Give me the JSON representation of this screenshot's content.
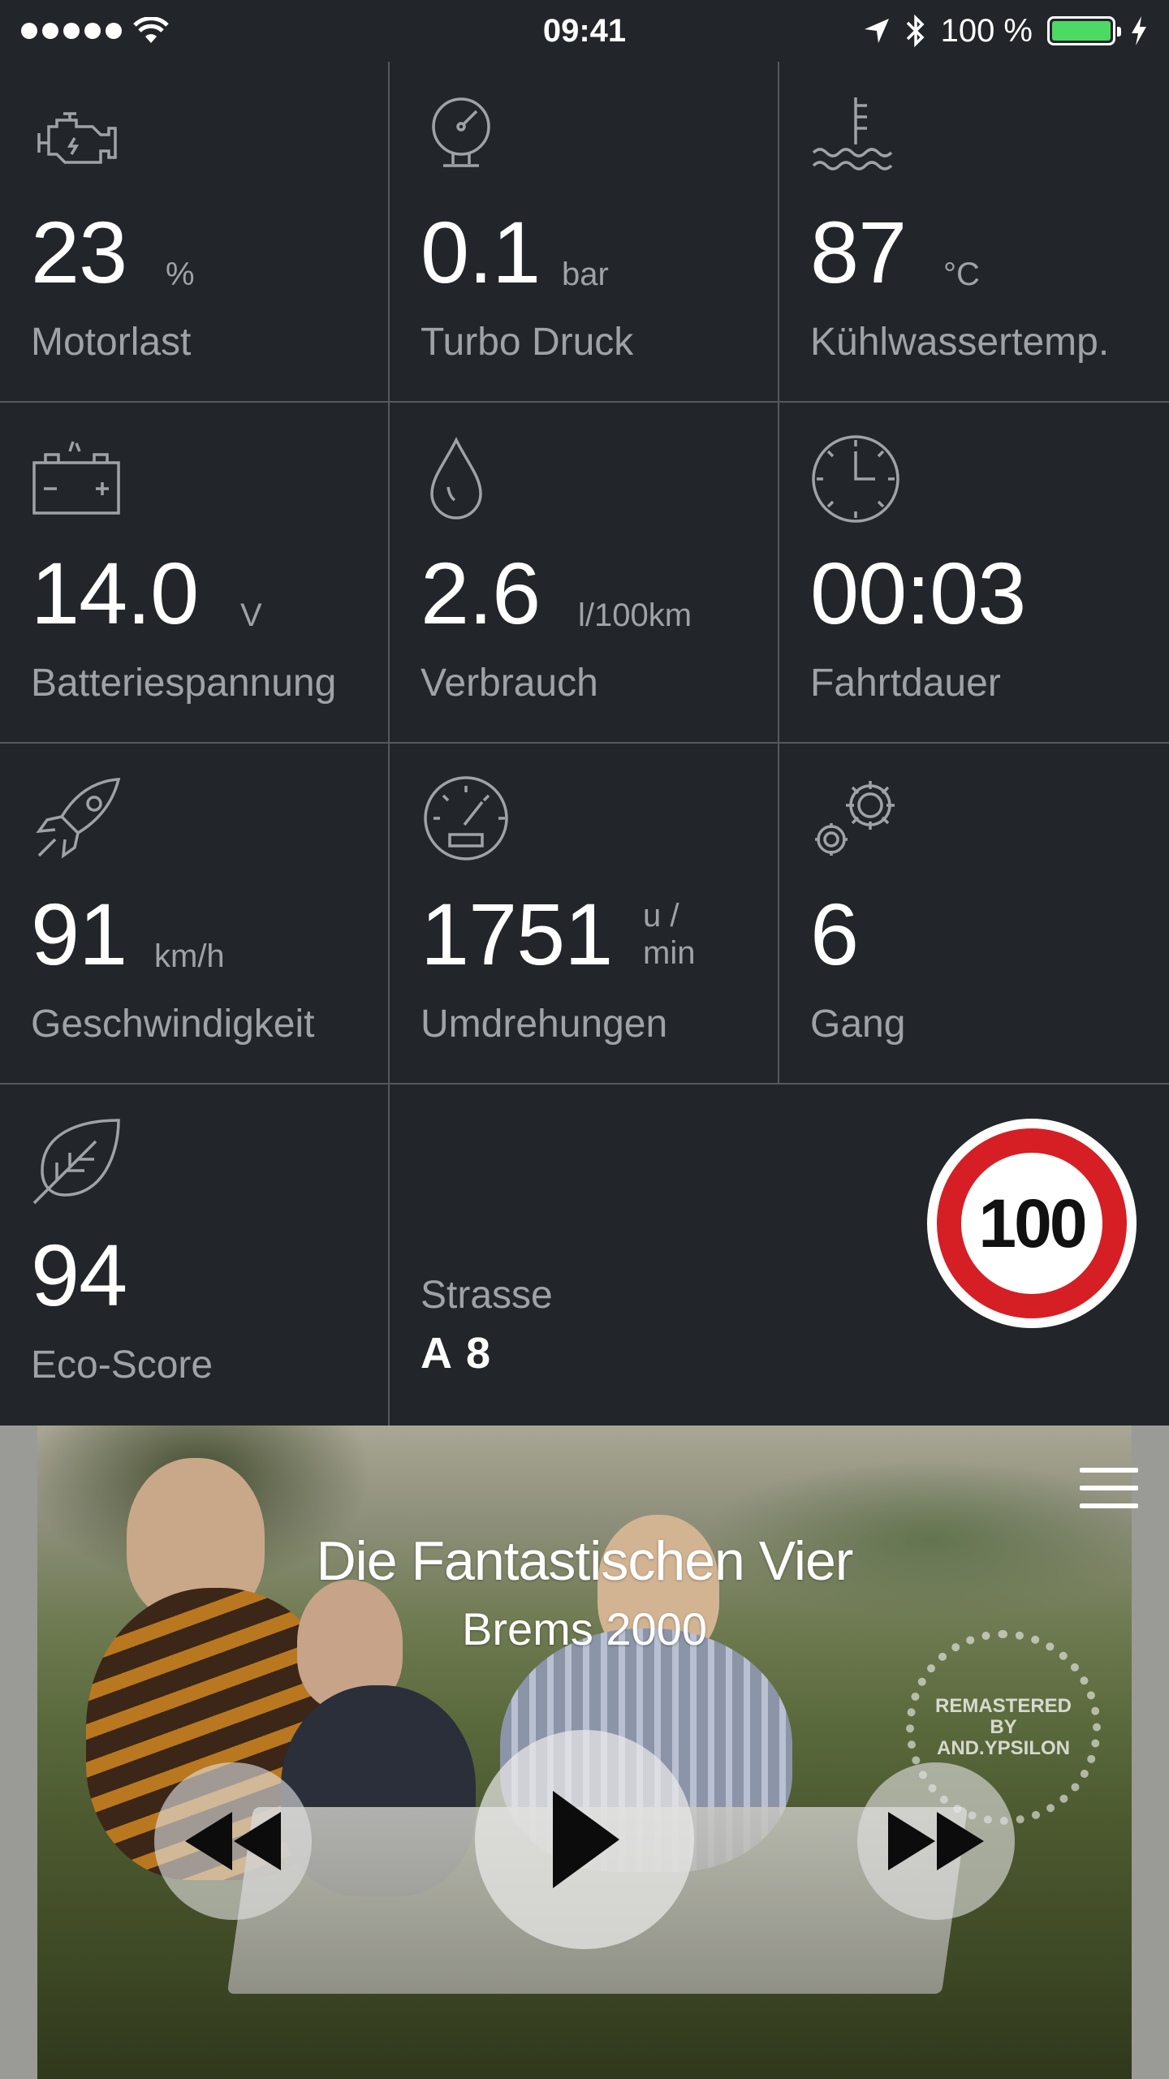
{
  "status_bar": {
    "time": "09:41",
    "battery_text": "100 %",
    "battery_level": 1.0,
    "signal_bars": 5,
    "icons": [
      "signal-dots-icon",
      "wifi-icon",
      "location-arrow-icon",
      "bluetooth-icon",
      "battery-icon",
      "charging-bolt-icon"
    ]
  },
  "tiles": [
    {
      "icon": "engine-icon",
      "value": "23",
      "unit": "%",
      "label": "Motorlast"
    },
    {
      "icon": "pressure-gauge-icon",
      "value": "0.1",
      "unit": "bar",
      "label": "Turbo Druck"
    },
    {
      "icon": "coolant-temperature-icon",
      "value": "87",
      "unit": "°C",
      "label": "Kühlwassertemp."
    },
    {
      "icon": "battery-car-icon",
      "value": "14.0",
      "unit": "V",
      "label": "Batteriespannung"
    },
    {
      "icon": "fuel-drop-icon",
      "value": "2.6",
      "unit": "l/100km",
      "label": "Verbrauch"
    },
    {
      "icon": "clock-icon",
      "value": "00:03",
      "unit": "",
      "label": "Fahrtdauer"
    },
    {
      "icon": "rocket-icon",
      "value": "91",
      "unit": "km/h",
      "label": "Geschwindigkeit"
    },
    {
      "icon": "speedometer-icon",
      "value": "1751",
      "unit_line1": "u /",
      "unit_line2": "min",
      "label": "Umdrehungen"
    },
    {
      "icon": "gears-icon",
      "value": "6",
      "unit": "",
      "label": "Gang"
    },
    {
      "icon": "leaf-icon",
      "value": "94",
      "unit": "",
      "label": "Eco-Score"
    }
  ],
  "road": {
    "label": "Strasse",
    "value": "A 8",
    "speed_limit": "100",
    "sign_colors": {
      "ring": "#d51f24",
      "face": "#ffffff"
    }
  },
  "player": {
    "artist": "Die Fantastischen Vier",
    "title": "Brems 2000",
    "badge_line1": "REMASTERED",
    "badge_line2": "BY",
    "badge_line3": "AND.YPSILON",
    "controls": [
      "rewind-icon",
      "play-icon",
      "fast-forward-icon"
    ],
    "menu_icon": "hamburger-menu-icon"
  },
  "colors": {
    "background": "#222529",
    "divider": "#55595e",
    "label": "#9fa3a8",
    "value": "#ffffff",
    "battery_green": "#4cd964"
  }
}
